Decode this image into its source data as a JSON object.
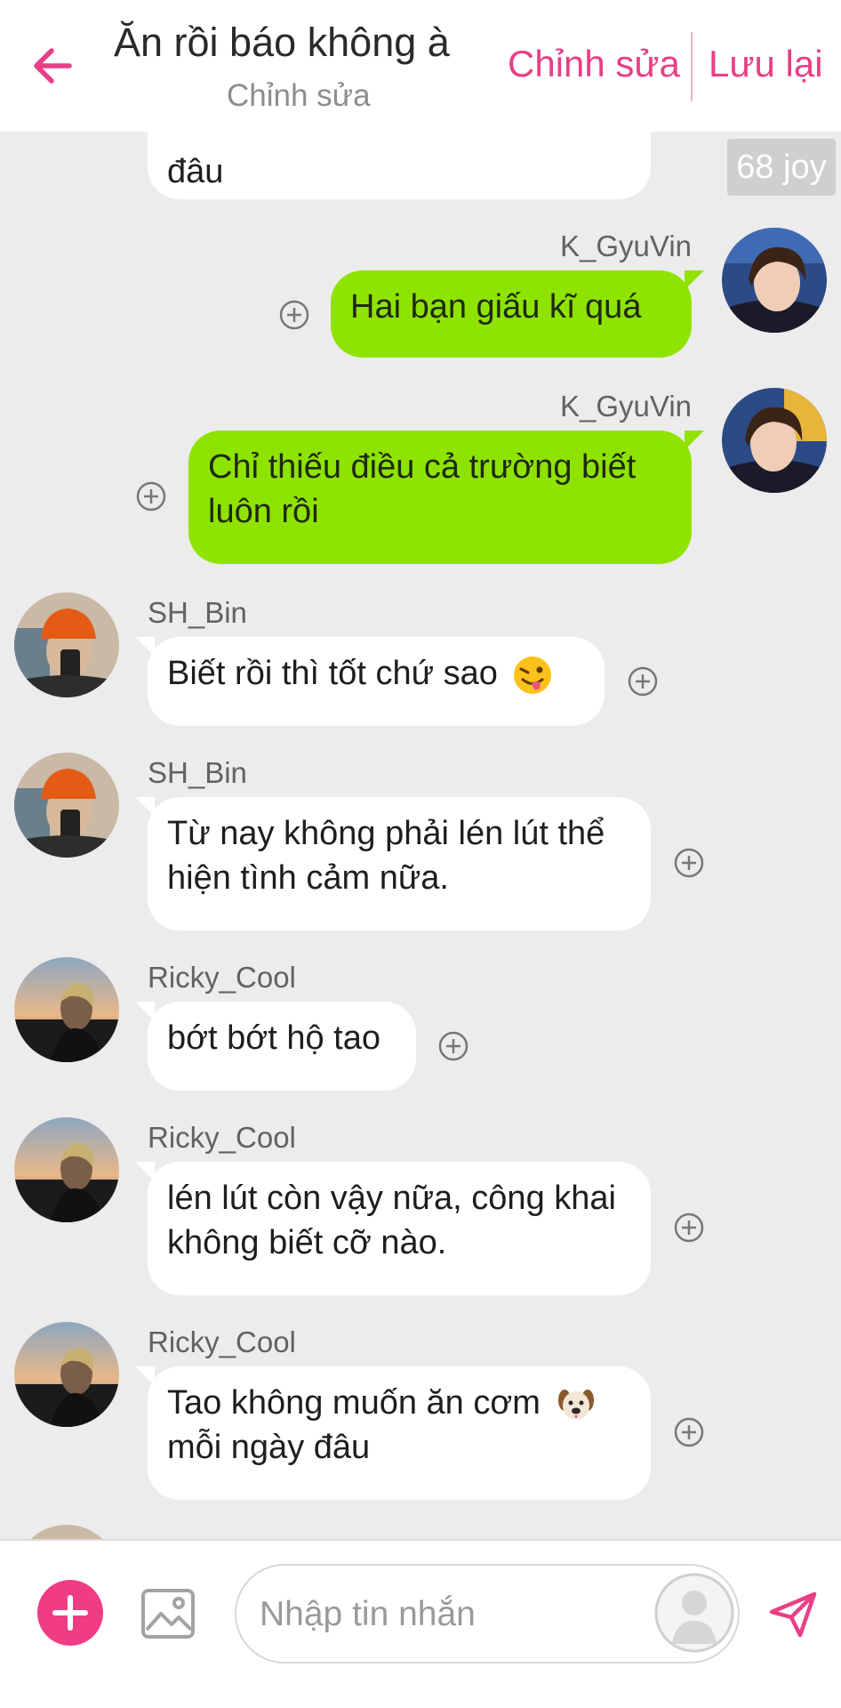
{
  "header": {
    "back_icon": "arrow-left-icon",
    "title": "Ăn rồi báo không à",
    "subtitle": "Chỉnh sửa",
    "edit_label": "Chỉnh sửa",
    "save_label": "Lưu lại",
    "accent_color": "#e83f86"
  },
  "chat": {
    "partial_message": "đâu",
    "joy_badge": "68 joy",
    "messages": [
      {
        "sender": "K_GyuVin",
        "text": "Hai bạn giấu kĩ quá",
        "direction": "out"
      },
      {
        "sender": "K_GyuVin",
        "text": "Chỉ thiếu điều cả trường biết luôn rồi",
        "direction": "out"
      },
      {
        "sender": "SH_Bin",
        "text": "Biết rồi thì tốt chứ sao",
        "emoji": "winking-tongue-emoji",
        "direction": "in"
      },
      {
        "sender": "SH_Bin",
        "text": "Từ nay không phải lén lút thể hiện tình cảm nữa.",
        "direction": "in"
      },
      {
        "sender": "Ricky_Cool",
        "text": "bớt bớt hộ tao",
        "direction": "in"
      },
      {
        "sender": "Ricky_Cool",
        "text": "lén lút còn vậy nữa, công khai không biết cỡ nào.",
        "direction": "in"
      },
      {
        "sender": "Ricky_Cool",
        "text": "Tao không muốn ăn cơm",
        "text2": "mỗi ngày đâu",
        "emoji": "dog-face-emoji",
        "direction": "in"
      }
    ],
    "outgoing_bubble_color": "#8fe300",
    "react_icon": "plus-circle-icon"
  },
  "composer": {
    "plus_icon": "plus-icon",
    "image_icon": "image-icon",
    "placeholder": "Nhập tin nhắn",
    "value": "",
    "avatar_icon": "default-avatar-icon",
    "send_icon": "send-icon",
    "accent_color": "#ef3c84"
  }
}
